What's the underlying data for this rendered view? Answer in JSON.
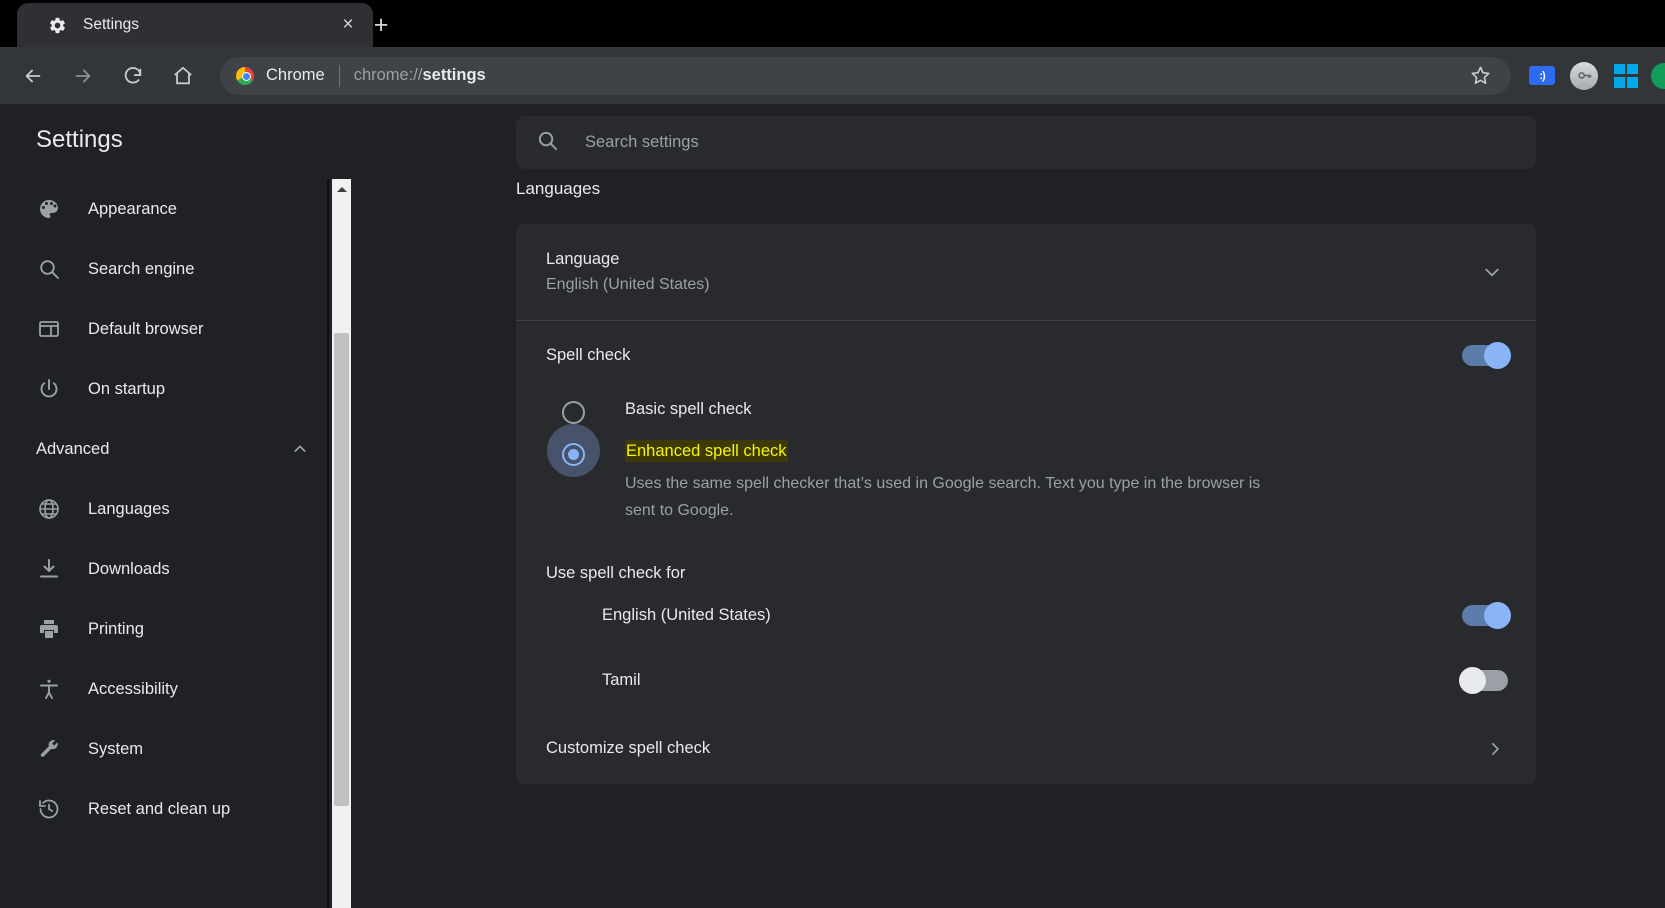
{
  "browser": {
    "tab": {
      "title": "Settings",
      "favicon": "gear-icon",
      "close": "×"
    },
    "new_tab": "+",
    "nav": {
      "back": "←",
      "forward": "→",
      "reload": "↻",
      "home": "⌂"
    },
    "omnibox": {
      "brand": "Chrome",
      "url_prefix": "chrome://",
      "url_bold": "settings",
      "separator": "|"
    },
    "toolbar_icons": [
      {
        "name": "bookmark-star-icon",
        "label": "☆"
      },
      {
        "name": "extension-tag-icon",
        "label": ":)"
      },
      {
        "name": "profile-key-avatar-icon",
        "label": "⚷"
      },
      {
        "name": "windows-logo-icon",
        "label": ""
      },
      {
        "name": "edge-partial-icon",
        "label": ""
      }
    ]
  },
  "settings": {
    "title": "Settings",
    "search": {
      "placeholder": "Search settings",
      "value": "",
      "icon": "search-icon"
    }
  },
  "sidebar": {
    "items": [
      {
        "label": "Appearance",
        "icon": "palette-icon"
      },
      {
        "label": "Search engine",
        "icon": "search-icon"
      },
      {
        "label": "Default browser",
        "icon": "browser-window-icon"
      },
      {
        "label": "On startup",
        "icon": "power-icon"
      }
    ],
    "section": {
      "label": "Advanced",
      "expanded_icon": "chevron-up-icon"
    },
    "advanced_items": [
      {
        "label": "Languages",
        "icon": "globe-icon"
      },
      {
        "label": "Downloads",
        "icon": "download-icon"
      },
      {
        "label": "Printing",
        "icon": "printer-icon"
      },
      {
        "label": "Accessibility",
        "icon": "accessibility-icon"
      },
      {
        "label": "System",
        "icon": "wrench-icon"
      },
      {
        "label": "Reset and clean up",
        "icon": "history-restore-icon"
      }
    ]
  },
  "main": {
    "section_title": "Languages",
    "language_row": {
      "name": "Language",
      "value": "English (United States)",
      "expand_icon": "chevron-down-icon"
    },
    "spell_check": {
      "label": "Spell check",
      "enabled": true,
      "options": [
        {
          "label": "Basic spell check",
          "selected": false,
          "description": ""
        },
        {
          "label": "Enhanced spell check",
          "selected": true,
          "highlighted": true,
          "description": "Uses the same spell checker that’s used in Google search. Text you type in the browser is sent to Google."
        }
      ]
    },
    "use_spell_check_for": {
      "title": "Use spell check for",
      "languages": [
        {
          "name": "English (United States)",
          "enabled": true
        },
        {
          "name": "Tamil",
          "enabled": false
        }
      ]
    },
    "customize": {
      "label": "Customize spell check",
      "icon": "chevron-right-icon"
    }
  },
  "colors": {
    "accent_blue": "#8ab4f8",
    "highlight_bg": "#3d3a06",
    "highlight_text": "#f4f412",
    "page_bg": "#202124",
    "card_bg": "#292a2d"
  }
}
